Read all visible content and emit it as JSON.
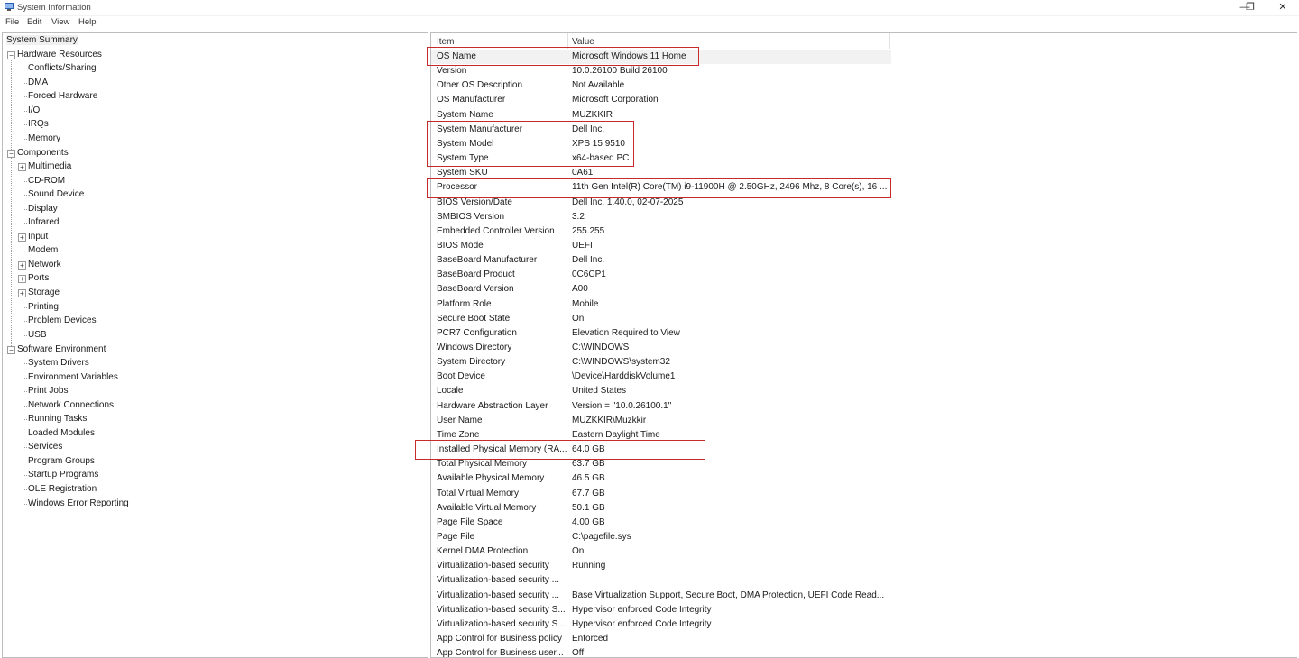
{
  "window": {
    "title": "System Information",
    "minimize": "—",
    "restore": "❐",
    "close": "✕"
  },
  "menu": [
    "File",
    "Edit",
    "View",
    "Help"
  ],
  "tree": {
    "root": "System Summary",
    "hardware": {
      "label": "Hardware Resources",
      "children": [
        "Conflicts/Sharing",
        "DMA",
        "Forced Hardware",
        "I/O",
        "IRQs",
        "Memory"
      ]
    },
    "components": {
      "label": "Components",
      "children": [
        {
          "label": "Multimedia",
          "expandable": true
        },
        {
          "label": "CD-ROM"
        },
        {
          "label": "Sound Device"
        },
        {
          "label": "Display"
        },
        {
          "label": "Infrared"
        },
        {
          "label": "Input",
          "expandable": true
        },
        {
          "label": "Modem"
        },
        {
          "label": "Network",
          "expandable": true
        },
        {
          "label": "Ports",
          "expandable": true
        },
        {
          "label": "Storage",
          "expandable": true
        },
        {
          "label": "Printing"
        },
        {
          "label": "Problem Devices"
        },
        {
          "label": "USB"
        }
      ]
    },
    "software": {
      "label": "Software Environment",
      "children": [
        "System Drivers",
        "Environment Variables",
        "Print Jobs",
        "Network Connections",
        "Running Tasks",
        "Loaded Modules",
        "Services",
        "Program Groups",
        "Startup Programs",
        "OLE Registration",
        "Windows Error Reporting"
      ]
    }
  },
  "columns": {
    "item": "Item",
    "value": "Value"
  },
  "rows": [
    {
      "item": "OS Name",
      "value": "Microsoft Windows 11 Home"
    },
    {
      "item": "Version",
      "value": "10.0.26100 Build 26100"
    },
    {
      "item": "Other OS Description",
      "value": "Not Available"
    },
    {
      "item": "OS Manufacturer",
      "value": "Microsoft Corporation"
    },
    {
      "item": "System Name",
      "value": "MUZKKIR"
    },
    {
      "item": "System Manufacturer",
      "value": "Dell Inc."
    },
    {
      "item": "System Model",
      "value": "XPS 15 9510"
    },
    {
      "item": "System Type",
      "value": "x64-based PC"
    },
    {
      "item": "System SKU",
      "value": "0A61"
    },
    {
      "item": "Processor",
      "value": "11th Gen Intel(R) Core(TM) i9-11900H @ 2.50GHz, 2496 Mhz, 8 Core(s), 16 ..."
    },
    {
      "item": "BIOS Version/Date",
      "value": "Dell Inc. 1.40.0, 02-07-2025"
    },
    {
      "item": "SMBIOS Version",
      "value": "3.2"
    },
    {
      "item": "Embedded Controller Version",
      "value": "255.255"
    },
    {
      "item": "BIOS Mode",
      "value": "UEFI"
    },
    {
      "item": "BaseBoard Manufacturer",
      "value": "Dell Inc."
    },
    {
      "item": "BaseBoard Product",
      "value": "0C6CP1"
    },
    {
      "item": "BaseBoard Version",
      "value": "A00"
    },
    {
      "item": "Platform Role",
      "value": "Mobile"
    },
    {
      "item": "Secure Boot State",
      "value": "On"
    },
    {
      "item": "PCR7 Configuration",
      "value": "Elevation Required to View"
    },
    {
      "item": "Windows Directory",
      "value": "C:\\WINDOWS"
    },
    {
      "item": "System Directory",
      "value": "C:\\WINDOWS\\system32"
    },
    {
      "item": "Boot Device",
      "value": "\\Device\\HarddiskVolume1"
    },
    {
      "item": "Locale",
      "value": "United States"
    },
    {
      "item": "Hardware Abstraction Layer",
      "value": "Version = \"10.0.26100.1\""
    },
    {
      "item": "User Name",
      "value": "MUZKKIR\\Muzkkir"
    },
    {
      "item": "Time Zone",
      "value": "Eastern Daylight Time"
    },
    {
      "item": "Installed Physical Memory (RA...",
      "value": "64.0 GB"
    },
    {
      "item": "Total Physical Memory",
      "value": "63.7 GB"
    },
    {
      "item": "Available Physical Memory",
      "value": "46.5 GB"
    },
    {
      "item": "Total Virtual Memory",
      "value": "67.7 GB"
    },
    {
      "item": "Available Virtual Memory",
      "value": "50.1 GB"
    },
    {
      "item": "Page File Space",
      "value": "4.00 GB"
    },
    {
      "item": "Page File",
      "value": "C:\\pagefile.sys"
    },
    {
      "item": "Kernel DMA Protection",
      "value": "On"
    },
    {
      "item": "Virtualization-based security",
      "value": "Running"
    },
    {
      "item": "Virtualization-based security ...",
      "value": ""
    },
    {
      "item": "Virtualization-based security ...",
      "value": "Base Virtualization Support, Secure Boot, DMA Protection, UEFI Code Read..."
    },
    {
      "item": "Virtualization-based security S...",
      "value": "Hypervisor enforced Code Integrity"
    },
    {
      "item": "Virtualization-based security S...",
      "value": "Hypervisor enforced Code Integrity"
    },
    {
      "item": "App Control for Business policy",
      "value": "Enforced"
    },
    {
      "item": "App Control for Business user...",
      "value": "Off"
    }
  ],
  "colors": {
    "highlight": "#c8292c",
    "selection": "#f2f2f2"
  }
}
